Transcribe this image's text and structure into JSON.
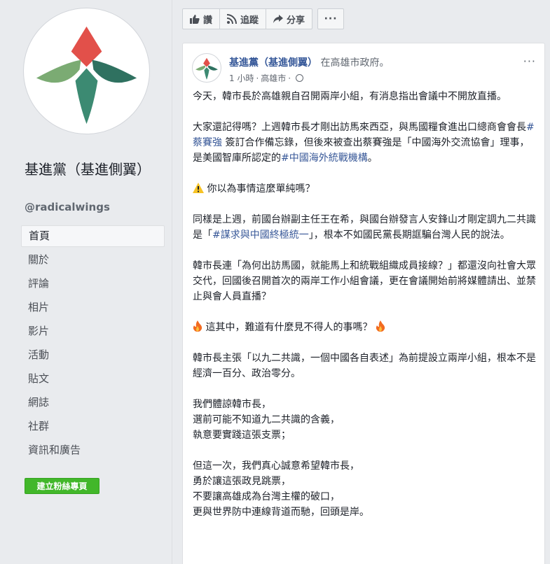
{
  "page": {
    "name": "基進黨（基進側翼）",
    "handle": "@radicalwings"
  },
  "nav": {
    "items": [
      "首頁",
      "關於",
      "評論",
      "相片",
      "影片",
      "活動",
      "貼文",
      "網誌",
      "社群",
      "資訊和廣告"
    ]
  },
  "create_page_button": "建立粉絲專頁",
  "actions": {
    "like": "讚",
    "follow": "追蹤",
    "share": "分享",
    "more": "···"
  },
  "post": {
    "author": "基進黨（基進側翼）",
    "location_text": "在高雄市政府。",
    "time": "1 小時",
    "place": "高雄市",
    "more": "···",
    "p1": "今天，韓市長於高雄親自召開兩岸小組，有消息指出會議中不開放直播。",
    "p2_a": "大家還記得嗎？上週韓市長才剛出訪馬來西亞，與馬國糧食進出口總商會會長",
    "p2_tag1": "#蔡賽強",
    "p2_b": " 簽訂合作備忘錄，但後來被查出蔡賽強是「中國海外交流協會」理事，是美國智庫所認定的",
    "p2_tag2": "#中國海外統戰機構",
    "p2_c": "。",
    "p3": "你以為事情這麼單純嗎？",
    "p4_a": "同樣是上週，前國台辦副主任王在希，與國台辦發言人安鋒山才剛定調九二共識是「",
    "p4_tag": "#謀求與中國終極統一",
    "p4_b": "」，根本不如國民黨長期誆騙台灣人民的說法。",
    "p5": "韓市長連「為何出訪馬國，就能馬上和統戰組織成員接線？」都還沒向社會大眾交代，回國後召開首次的兩岸工作小組會議，更在會議開始前將媒體請出、並禁止與會人員直播？",
    "p6": "這其中，難道有什麼見不得人的事嗎？",
    "p7": "韓市長主張「以九二共識，一個中國各自表述」為前提設立兩岸小組，根本不是經濟一百分、政治零分。",
    "p8_1": "我們體諒韓市長，",
    "p8_2": "選前可能不知道九二共識的含義，",
    "p8_3": "執意要實踐這張支票；",
    "p9_1": "但這一次，我們真心誠意希望韓市長，",
    "p9_2": "勇於讓這張政見跳票，",
    "p9_3": "不要讓高雄成為台灣主權的破口，",
    "p9_4": "更與世界防中連線背道而馳，回頭是岸。"
  },
  "colors": {
    "link": "#385898",
    "author": "#365899",
    "create_button": "#42b72a",
    "logo_red": "#e2504a",
    "logo_green_light": "#7bab73",
    "logo_green_dark": "#2f7160",
    "logo_green_mid": "#3c8a72"
  }
}
